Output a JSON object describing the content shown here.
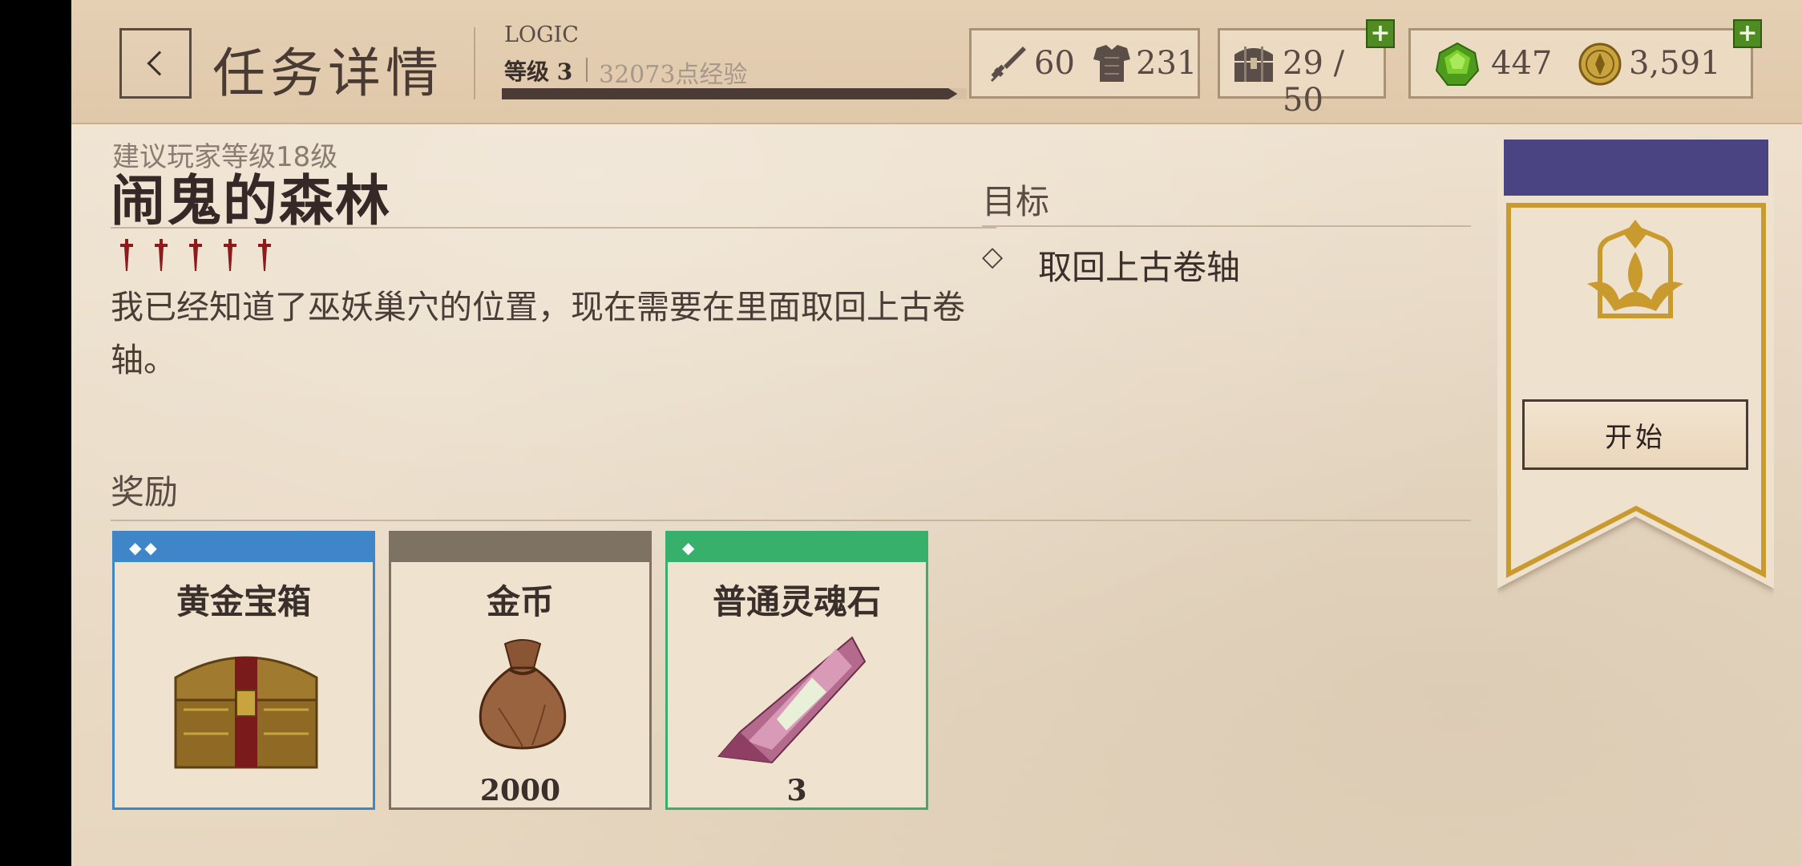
{
  "header": {
    "page_title": "任务详情",
    "player_name": "LOGIC",
    "player_level": "等级 3",
    "player_xp": "32073点经验",
    "xp_progress": 0.98
  },
  "stats": {
    "attack": "60",
    "armor": "231",
    "inventory": "29 / 50",
    "gems": "447",
    "gold": "3,591"
  },
  "quest": {
    "recommended_level": "建议玩家等级18级",
    "name": "闹鬼的森林",
    "difficulty": 5,
    "description": "我已经知道了巫妖巢穴的位置，现在需要在里面取回上古卷轴。"
  },
  "objectives": {
    "title": "目标",
    "items": [
      {
        "marker": "◇",
        "text": "取回上古卷轴"
      }
    ]
  },
  "rewards": {
    "title": "奖励",
    "items": [
      {
        "name": "黄金宝箱",
        "count": "",
        "rarity_marks": "◆◆",
        "color": "#3f86c8"
      },
      {
        "name": "金币",
        "count": "2000",
        "rarity_marks": "",
        "color": "#7e7262"
      },
      {
        "name": "普通灵魂石",
        "count": "3",
        "rarity_marks": "◆",
        "color": "#36b06a"
      }
    ]
  },
  "banner": {
    "start_label": "开始",
    "banner_color": "#4a4582",
    "emblem_color": "#c99a2e"
  },
  "icons": {
    "back": "chevron-left-icon",
    "attack": "sword-icon",
    "armor": "armor-icon",
    "inventory": "chest-icon",
    "gems": "green-gem-icon",
    "gold": "gold-coin-icon",
    "plus": "plus-icon"
  }
}
